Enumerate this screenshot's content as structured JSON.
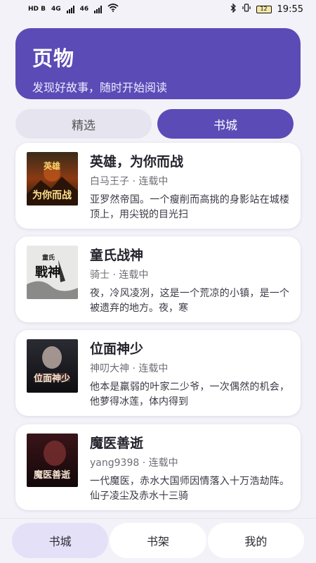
{
  "status_bar": {
    "network_left": "HD B",
    "net1": "4G",
    "net2": "46",
    "battery": "12",
    "time": "19:55"
  },
  "hero": {
    "title": "页物",
    "subtitle": "发现好故事，随时开始阅读"
  },
  "tabs": [
    {
      "label": "精选",
      "active": false
    },
    {
      "label": "书城",
      "active": true
    }
  ],
  "books": [
    {
      "title": "英雄，为你而战",
      "meta": "白马王子 · 连载中",
      "desc": "亚罗然帝国。一个瘦削而高挑的身影站在城楼顶上，用尖锐的目光扫",
      "cover_text": "为你而战",
      "cover_top": "英雄"
    },
    {
      "title": "童氏战神",
      "meta": "骑士 · 连载中",
      "desc": "夜，冷风凌冽，这是一个荒凉的小镇，是一个被遗弃的地方。夜，寒",
      "cover_text": "戰神",
      "cover_top": "童氏"
    },
    {
      "title": "位面神少",
      "meta": "神叨大神 · 连载中",
      "desc": "他本是羸弱的叶家二少爷，一次偶然的机会，他萝得冰莲，体内得到",
      "cover_text": "位面神少",
      "cover_top": ""
    },
    {
      "title": "魔医善逝",
      "meta": "yang9398 · 连载中",
      "desc": "一代魔医，赤水大国师因情落入十万浩劫阵。仙子凌尘及赤水十三骑",
      "cover_text": "魔医善逝",
      "cover_top": ""
    }
  ],
  "bottom_nav": [
    {
      "label": "书城",
      "active": true
    },
    {
      "label": "书架",
      "active": false
    },
    {
      "label": "我的",
      "active": false
    }
  ],
  "colors": {
    "accent": "#5b4bb6",
    "background": "#f3f2f8"
  }
}
